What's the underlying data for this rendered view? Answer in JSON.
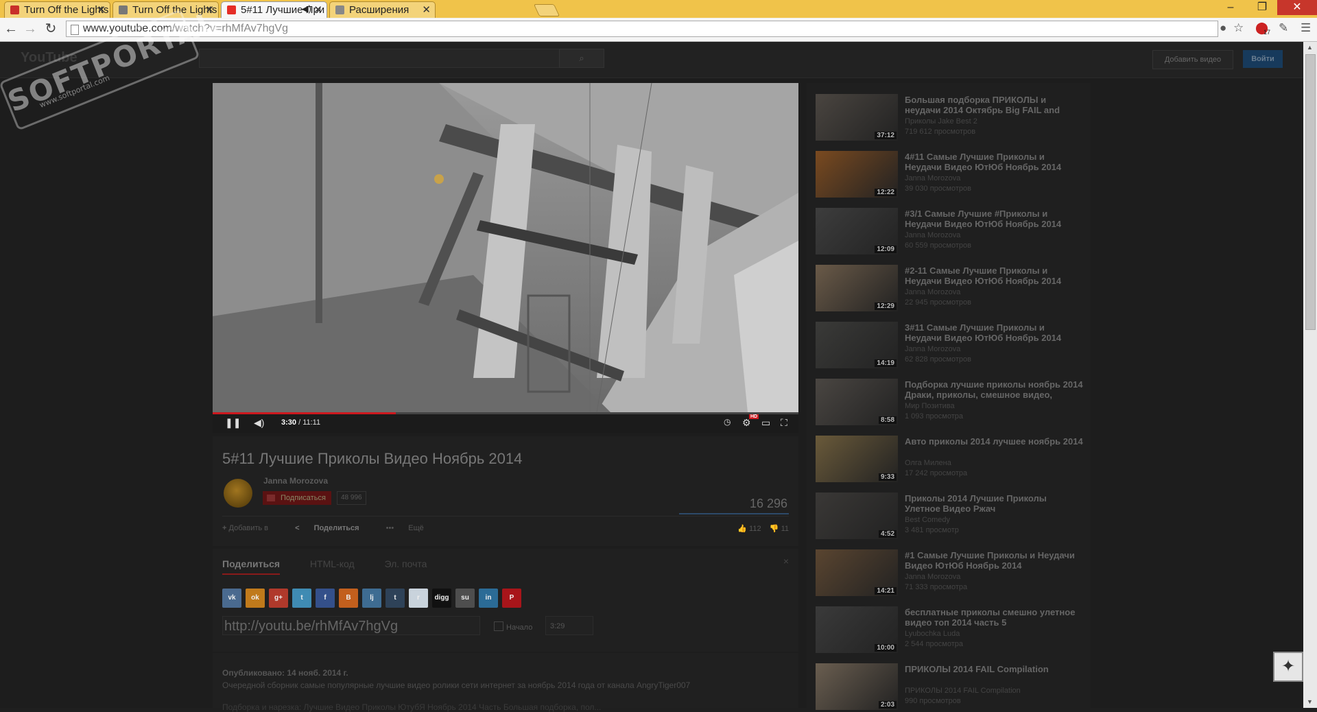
{
  "browser": {
    "tabs": [
      {
        "title": "Turn Off the Lights -",
        "icon_color": "#c8302a"
      },
      {
        "title": "Turn Off the Lights | .",
        "icon_color": "#777777"
      },
      {
        "title": "5#11 Лучшие При",
        "icon_color": "#e52d27"
      },
      {
        "title": "Расширения",
        "icon_color": "#888888"
      }
    ],
    "url_host": "www.youtube.com",
    "url_path": "/watch?v=rhMfAv7hgVg",
    "extension_badge": "17"
  },
  "watermark": {
    "title": "SOFTPORTAL",
    "url": "www.softportal.com"
  },
  "header": {
    "logo": "YouTube",
    "search_icon": "magnifier-icon",
    "upload_label": "Добавить видео",
    "login_label": "Войти"
  },
  "player": {
    "current_time": "3:30",
    "duration": "11:11",
    "progress": 0.313,
    "hd_label": "HD"
  },
  "video": {
    "title": "5#11 Лучшие Приколы Видео Ноябрь 2014",
    "channel": "Janna Morozova",
    "subscribe_label": "Подписаться",
    "subscribers": "48 996",
    "views": "16 296",
    "add_to_label": "Добавить в",
    "share_label": "Поделиться",
    "more_label": "Ещё",
    "likes": "112",
    "dislikes": "11"
  },
  "share": {
    "tabs": [
      "Поделиться",
      "HTML-код",
      "Эл. почта"
    ],
    "link": "http://youtu.be/rhMfAv7hgVg",
    "start_label": "Начало",
    "start_time": "3:29",
    "close": "×",
    "networks": [
      {
        "name": "vk-icon",
        "color": "#4a6a8f",
        "glyph": "vk"
      },
      {
        "name": "odnoklassniki-icon",
        "color": "#c07a1b",
        "glyph": "ok"
      },
      {
        "name": "google-plus-icon",
        "color": "#b0392b",
        "glyph": "g+"
      },
      {
        "name": "twitter-icon",
        "color": "#3f8bb3",
        "glyph": "t"
      },
      {
        "name": "facebook-icon",
        "color": "#34508a",
        "glyph": "f"
      },
      {
        "name": "blogger-icon",
        "color": "#c25f1d",
        "glyph": "B"
      },
      {
        "name": "livejournal-icon",
        "color": "#3e6c92",
        "glyph": "lj"
      },
      {
        "name": "tumblr-icon",
        "color": "#2e4258",
        "glyph": "t"
      },
      {
        "name": "reddit-icon",
        "color": "#c9d3dc",
        "glyph": "r"
      },
      {
        "name": "digg-icon",
        "color": "#111111",
        "glyph": "digg"
      },
      {
        "name": "stumbleupon-icon",
        "color": "#4e4e4e",
        "glyph": "su"
      },
      {
        "name": "linkedin-icon",
        "color": "#2b6b96",
        "glyph": "in"
      },
      {
        "name": "pinterest-icon",
        "color": "#a8151a",
        "glyph": "P"
      }
    ]
  },
  "description": {
    "published": "Опубликовано: 14 нояб. 2014 г.",
    "text": "Очередной сборник самые популярные лучшие видео ролики сети интернет за ноябрь 2014 года от канала AngryTiger007",
    "text2": "Подборка и нарезка: Лучшие Видео Приколы ЮтубЯ Ноябрь 2014 Часть Большая подборка, пол..."
  },
  "related": [
    {
      "title": "Большая подборка ПРИКОЛЫ и неудачи 2014 Октябрь Big FAIL and",
      "author": "Приколы Jake Best 2",
      "views": "719 612 просмотров",
      "duration": "37:12",
      "tone": "#4a4540"
    },
    {
      "title": "4#11 Самые Лучшие Приколы и Неудачи Видео ЮтЮб Ноябрь 2014",
      "author": "Janna Morozova",
      "views": "39 030 просмотров",
      "duration": "12:22",
      "tone": "#7a4a20"
    },
    {
      "title": "#3/1 Самые Лучшие #Приколы и Неудачи Видео ЮтЮб Ноябрь 2014",
      "author": "Janna Morozova",
      "views": "60 559 просмотров",
      "duration": "12:09",
      "tone": "#3d3d3d"
    },
    {
      "title": "#2-11 Самые Лучшие Приколы и Неудачи Видео ЮтЮб Ноябрь 2014",
      "author": "Janna Morozova",
      "views": "22 945 просмотров",
      "duration": "12:29",
      "tone": "#6a5a48"
    },
    {
      "title": "3#11 Самые Лучшие Приколы и Неудачи Видео ЮтЮб Ноябрь 2014",
      "author": "Janna Morozova",
      "views": "62 828 просмотров",
      "duration": "14:19",
      "tone": "#3a3a38"
    },
    {
      "title": "Подборка лучшие приколы ноябрь 2014 Драки, приколы, смешное видео,",
      "author": "Мир Позитива",
      "views": "1 093 просмотра",
      "duration": "8:58",
      "tone": "#4a4642"
    },
    {
      "title": "Авто приколы 2014 лучшее ноябрь 2014",
      "author": "Олга Милена",
      "views": "17 242 просмотра",
      "duration": "9:33",
      "tone": "#6a5a3a"
    },
    {
      "title": "Приколы 2014 Лучшие Приколы Улетное Видео Ржач",
      "author": "Best Comedy",
      "views": "3 481 просмотр",
      "duration": "4:52",
      "tone": "#3a3836"
    },
    {
      "title": "#1 Самые Лучшие Приколы и Неудачи Видео ЮтЮб Ноябрь 2014",
      "author": "Janna Morozova",
      "views": "71 333 просмотра",
      "duration": "14:21",
      "tone": "#5a4530"
    },
    {
      "title": "бесплатные приколы смешно улетное видео топ 2014 часть 5",
      "author": "Lyubochka Luda",
      "views": "2 544 просмотра",
      "duration": "10:00",
      "tone": "#3a3a3a"
    },
    {
      "title": "ПРИКОЛЫ 2014 FAIL Compilation",
      "author": "ПРИКОЛЫ 2014 FAIL Compilation",
      "views": "990 просмотров",
      "duration": "2:03",
      "tone": "#6a5e50"
    }
  ]
}
